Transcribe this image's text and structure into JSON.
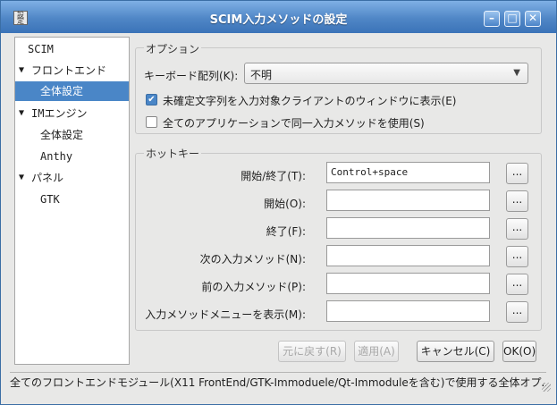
{
  "window": {
    "title": "SCIM入力メソッドの設定",
    "icon_text": "設 定",
    "minimize": "–",
    "maximize": "□",
    "close": "✕"
  },
  "sidebar": {
    "items": [
      {
        "label": "SCIM",
        "arrow": ""
      },
      {
        "label": "フロントエンド",
        "arrow": "▼"
      },
      {
        "label": "全体設定",
        "arrow": "",
        "selected": true
      },
      {
        "label": "IMエンジン",
        "arrow": "▼"
      },
      {
        "label": "全体設定",
        "arrow": ""
      },
      {
        "label": "Anthy",
        "arrow": ""
      },
      {
        "label": "パネル",
        "arrow": "▼"
      },
      {
        "label": "GTK",
        "arrow": ""
      }
    ]
  },
  "options": {
    "group_title": "オプション",
    "keyboard_label": "キーボード配列(K):",
    "keyboard_value": "不明",
    "keyboard_dropdown_icon": "▼",
    "check1_label": "未確定文字列を入力対象クライアントのウィンドウに表示(E)",
    "check1_checked": true,
    "check1_mark": "✔",
    "check2_label": "全てのアプリケーションで同一入力メソッドを使用(S)",
    "check2_checked": false
  },
  "hotkeys": {
    "group_title": "ホットキー",
    "rows": [
      {
        "label": "開始/終了(T):",
        "value": "Control+space",
        "button": "..."
      },
      {
        "label": "開始(O):",
        "value": "",
        "button": "..."
      },
      {
        "label": "終了(F):",
        "value": "",
        "button": "..."
      },
      {
        "label": "次の入力メソッド(N):",
        "value": "",
        "button": "..."
      },
      {
        "label": "前の入力メソッド(P):",
        "value": "",
        "button": "..."
      },
      {
        "label": "入力メソッドメニューを表示(M):",
        "value": "",
        "button": "..."
      }
    ]
  },
  "buttons": {
    "revert": "元に戻す(R)",
    "apply": "適用(A)",
    "cancel": "キャンセル(C)",
    "ok": "OK(O)"
  },
  "statusbar": {
    "text": "全てのフロントエンドモジュール(X11 FrontEnd/GTK-Immoduele/Qt-Immoduleを含む)で使用する全体オプ..."
  }
}
